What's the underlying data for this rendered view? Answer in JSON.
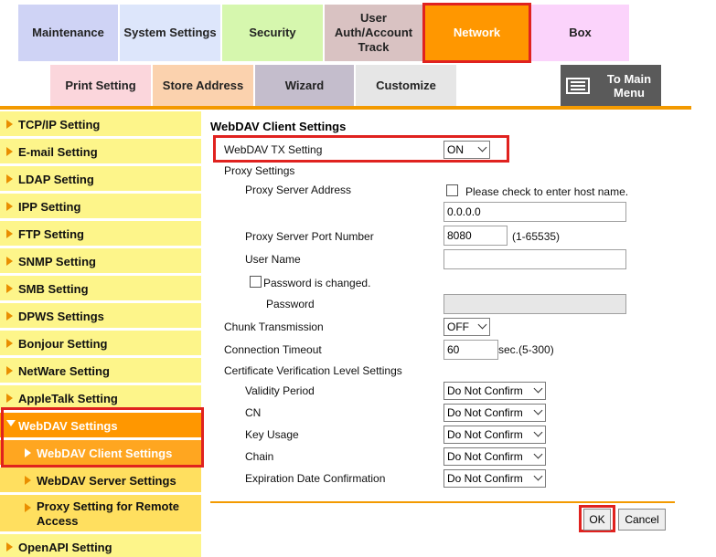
{
  "top_tabs": {
    "maintenance": "Maintenance",
    "system_settings": "System Settings",
    "security": "Security",
    "user_line1": "User",
    "user_line2": "Auth/Account",
    "user_line3": "Track",
    "network": "Network",
    "box": "Box"
  },
  "sub_tabs": {
    "print_setting": "Print Setting",
    "store_address": "Store Address",
    "wizard": "Wizard",
    "customize": "Customize",
    "main_menu_line1": "To Main",
    "main_menu_line2": "Menu"
  },
  "sidebar": {
    "items": [
      {
        "label": "TCP/IP Setting"
      },
      {
        "label": "E-mail Setting"
      },
      {
        "label": "LDAP Setting"
      },
      {
        "label": "IPP Setting"
      },
      {
        "label": "FTP Setting"
      },
      {
        "label": "SNMP Setting"
      },
      {
        "label": "SMB Setting"
      },
      {
        "label": "DPWS Settings"
      },
      {
        "label": "Bonjour Setting"
      },
      {
        "label": "NetWare Setting"
      },
      {
        "label": "AppleTalk Setting"
      },
      {
        "label": "WebDAV Settings"
      },
      {
        "label": "WebDAV Client Settings"
      },
      {
        "label": "WebDAV Server Settings"
      },
      {
        "label": "Proxy Setting for Remote",
        "label2": "Access"
      },
      {
        "label": "OpenAPI Setting"
      }
    ]
  },
  "form": {
    "title": "WebDAV Client Settings",
    "webdav_tx_label": "WebDAV TX Setting",
    "webdav_tx_value": "ON",
    "proxy_settings_label": "Proxy Settings",
    "proxy_address_label": "Proxy Server Address",
    "host_name_check_label": "Please check to enter host name.",
    "proxy_address_value": "0.0.0.0",
    "proxy_port_label": "Proxy Server Port Number",
    "proxy_port_value": "8080",
    "proxy_port_range": "(1-65535)",
    "user_name_label": "User Name",
    "user_name_value": "",
    "password_changed_label": "Password is changed.",
    "password_label": "Password",
    "chunk_label": "Chunk Transmission",
    "chunk_value": "OFF",
    "timeout_label": "Connection Timeout",
    "timeout_value": "60",
    "timeout_unit": "sec.(5-300)",
    "cert_level_label": "Certificate Verification Level Settings",
    "validity_label": "Validity Period",
    "validity_value": "Do Not Confirm",
    "cn_label": "CN",
    "cn_value": "Do Not Confirm",
    "key_usage_label": "Key Usage",
    "key_usage_value": "Do Not Confirm",
    "chain_label": "Chain",
    "chain_value": "Do Not Confirm",
    "expiration_label": "Expiration Date Confirmation",
    "expiration_value": "Do Not Confirm"
  },
  "buttons": {
    "ok": "OK",
    "cancel": "Cancel"
  },
  "colors": {
    "accent_orange": "#ff9700",
    "highlight_red": "#e0221f",
    "sidebar_yellow": "#fdf58a"
  }
}
